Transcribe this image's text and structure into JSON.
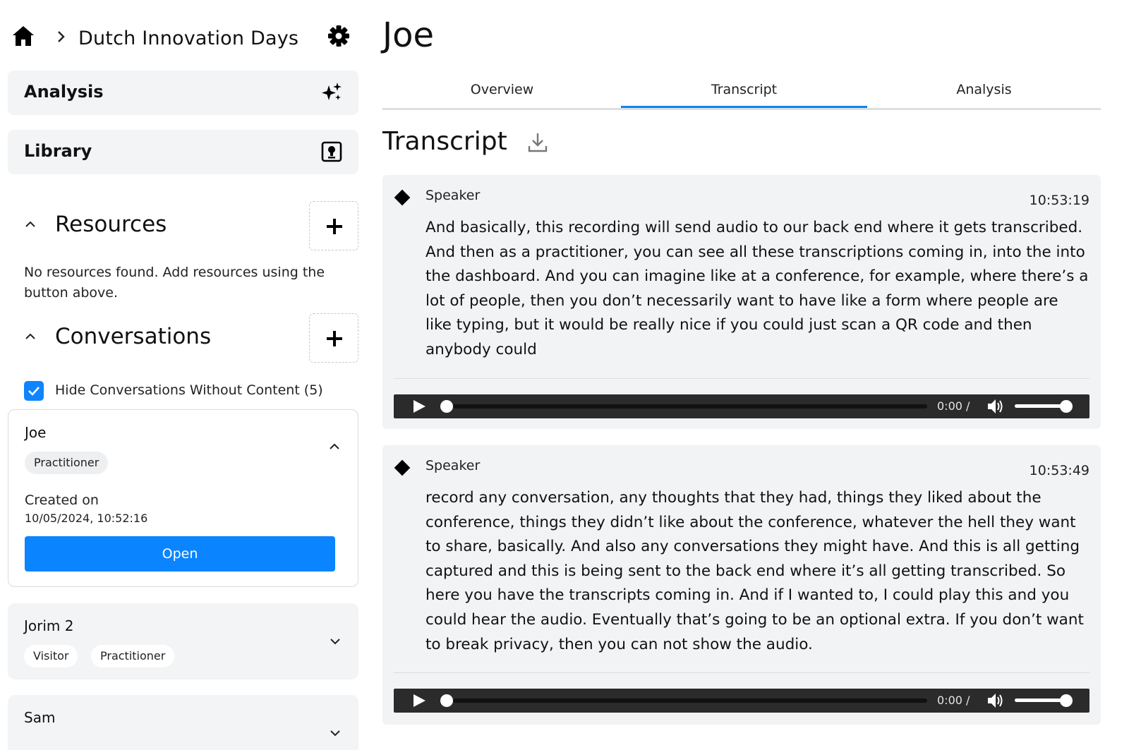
{
  "breadcrumb": {
    "home_icon": "home-icon",
    "separator_icon": "chevron-right-icon",
    "project": "Dutch Innovation Days",
    "settings_icon": "gear-icon"
  },
  "sidebar": {
    "nav": [
      {
        "label": "Analysis",
        "icon": "sparkles-icon"
      },
      {
        "label": "Library",
        "icon": "library-icon"
      }
    ],
    "resources": {
      "title": "Resources",
      "empty_message": "No resources found. Add resources using the button above."
    },
    "conversations": {
      "title": "Conversations",
      "hide_empty_label": "Hide Conversations Without Content (5)",
      "hide_empty_checked": true,
      "items": [
        {
          "name": "Joe",
          "tags": [
            "Practitioner"
          ],
          "expanded": true,
          "created_label": "Created on",
          "created_value": "10/05/2024, 10:52:16",
          "open_label": "Open"
        },
        {
          "name": "Jorim 2",
          "tags": [
            "Visitor",
            "Practitioner"
          ],
          "expanded": false
        },
        {
          "name": "Sam",
          "tags": [],
          "expanded": false
        }
      ]
    }
  },
  "main": {
    "title": "Joe",
    "tabs": [
      {
        "label": "Overview",
        "active": false
      },
      {
        "label": "Transcript",
        "active": true
      },
      {
        "label": "Analysis",
        "active": false
      }
    ],
    "section_title": "Transcript",
    "chunks": [
      {
        "speaker": "Speaker",
        "time": "10:53:19",
        "text": "And basically, this recording will send audio to our back end where it gets transcribed. And then as a practitioner, you can see all these transcriptions coming in, into the into the dashboard. And you can imagine like at a conference, for example, where there’s a lot of people, then you don’t necessarily want to have like a form where people are like typing, but it would be really nice if you could just scan a QR code and then anybody could",
        "player_time": "0:00 /"
      },
      {
        "speaker": "Speaker",
        "time": "10:53:49",
        "text": "record any conversation, any thoughts that they had, things they liked about the conference, things they didn’t like about the conference, whatever the hell they want to share, basically. And also any conversations they might have. And this is all getting captured and this is being sent to the back end where it’s all getting transcribed. So here you have the transcripts coming in. And if I wanted to, I could play this and you could hear the audio. Eventually that’s going to be an optional extra. If you don’t want to break privacy, then you can not show the audio.",
        "player_time": "0:00 /"
      }
    ]
  },
  "colors": {
    "accent": "#0a84ff",
    "tab_underline": "#1084e8",
    "card_bg": "#f3f4f5",
    "player_bg": "#2b2b2b"
  }
}
